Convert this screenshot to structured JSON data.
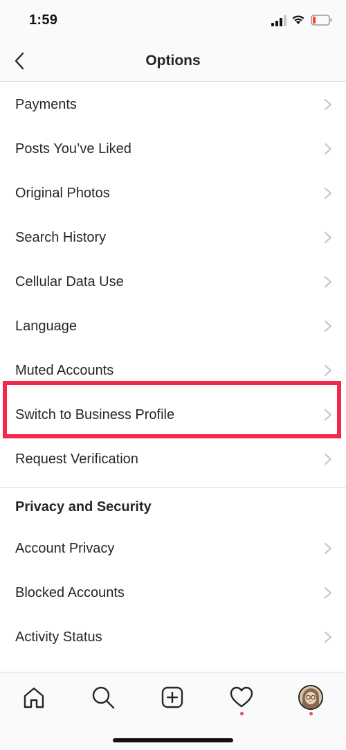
{
  "status_bar": {
    "time": "1:59"
  },
  "nav": {
    "title": "Options"
  },
  "rows_top": [
    {
      "label": "Payments"
    },
    {
      "label": "Posts You’ve Liked"
    },
    {
      "label": "Original Photos"
    },
    {
      "label": "Search History"
    },
    {
      "label": "Cellular Data Use"
    },
    {
      "label": "Language"
    },
    {
      "label": "Muted Accounts"
    },
    {
      "label": "Switch to Business Profile"
    },
    {
      "label": "Request Verification"
    }
  ],
  "privacy_section": {
    "header": "Privacy and Security",
    "rows": [
      {
        "label": "Account Privacy"
      },
      {
        "label": "Blocked Accounts"
      },
      {
        "label": "Activity Status"
      }
    ]
  },
  "colors": {
    "highlight": "#f2294a",
    "notification_dot": "#ed4956",
    "divider": "#dbdbdb",
    "chevron": "#c7c7cc"
  },
  "tab_bar": {
    "tabs": [
      "home-icon",
      "search-icon",
      "new-post-icon",
      "heart-icon",
      "profile-avatar"
    ]
  }
}
